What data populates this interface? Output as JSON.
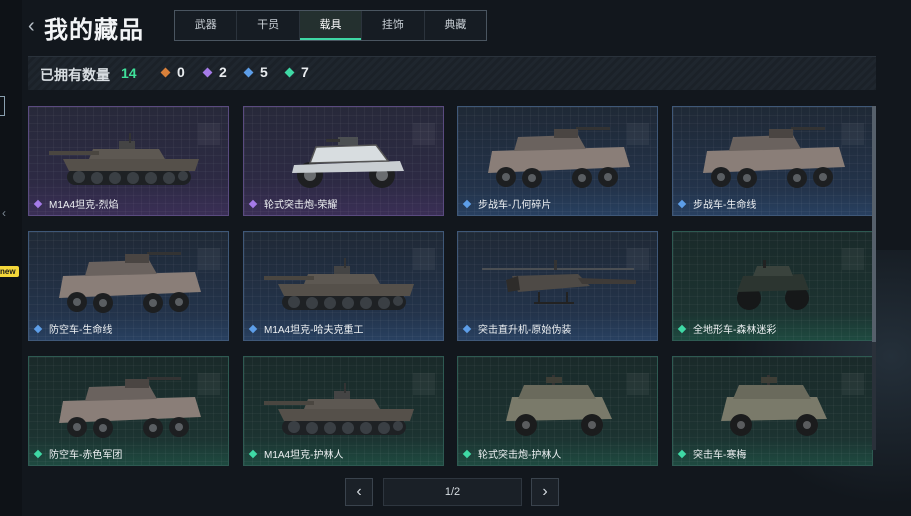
{
  "header": {
    "title": "我的藏品"
  },
  "tabs": [
    {
      "label": "武器",
      "active": false
    },
    {
      "label": "干员",
      "active": false
    },
    {
      "label": "载具",
      "active": true
    },
    {
      "label": "挂饰",
      "active": false
    },
    {
      "label": "典藏",
      "active": false
    }
  ],
  "counts": {
    "owned_label": "已拥有数量",
    "owned_value": "14",
    "rarities": [
      {
        "icon": "orange-diamond-icon",
        "color": "#d9803a",
        "value": "0"
      },
      {
        "icon": "purple-diamond-icon",
        "color": "#a57be8",
        "value": "2"
      },
      {
        "icon": "blue-diamond-icon",
        "color": "#5d9ee8",
        "value": "5"
      },
      {
        "icon": "green-diamond-icon",
        "color": "#3fd9a5",
        "value": "7"
      }
    ]
  },
  "side": {
    "new_badge": "new"
  },
  "items": [
    {
      "name": "M1A4坦克-烈焰",
      "rarity": "purple",
      "vehicle": "tank"
    },
    {
      "name": "轮式突击炮-荣耀",
      "rarity": "purple",
      "vehicle": "buggy"
    },
    {
      "name": "步战车-几何碎片",
      "rarity": "blue",
      "vehicle": "apc"
    },
    {
      "name": "步战车-生命线",
      "rarity": "blue",
      "vehicle": "apc"
    },
    {
      "name": "防空车-生命线",
      "rarity": "blue",
      "vehicle": "apc"
    },
    {
      "name": "M1A4坦克-哈夫克重工",
      "rarity": "blue",
      "vehicle": "tank"
    },
    {
      "name": "突击直升机-原始伪装",
      "rarity": "blue",
      "vehicle": "heli"
    },
    {
      "name": "全地形车-森林迷彩",
      "rarity": "green",
      "vehicle": "atv"
    },
    {
      "name": "防空车-赤色军团",
      "rarity": "green",
      "vehicle": "apc"
    },
    {
      "name": "M1A4坦克-护林人",
      "rarity": "green",
      "vehicle": "tank"
    },
    {
      "name": "轮式突击炮-护林人",
      "rarity": "green",
      "vehicle": "jeep"
    },
    {
      "name": "突击车-寒梅",
      "rarity": "green",
      "vehicle": "jeep"
    }
  ],
  "pager": {
    "text": "1/2",
    "prev": "‹",
    "next": "›"
  }
}
